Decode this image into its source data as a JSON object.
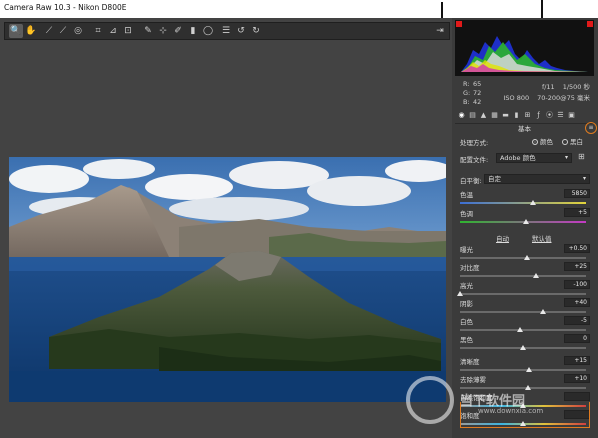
{
  "window": {
    "title": "Camera Raw 10.3 - Nikon D800E"
  },
  "toolbar": {
    "tools": [
      "zoom-icon",
      "hand-icon",
      "white-balance-icon",
      "color-sampler-icon",
      "target-adjust-icon",
      "crop-icon",
      "straighten-icon",
      "transform-icon",
      "spot-removal-icon",
      "red-eye-icon",
      "adjustment-brush-icon",
      "graduated-filter-icon",
      "radial-filter-icon",
      "presets-list-icon",
      "rotate-ccw-icon",
      "rotate-cw-icon"
    ],
    "right_tool": "open-preferences-icon"
  },
  "readout": {
    "r_label": "R:",
    "r": "65",
    "g_label": "G:",
    "g": "72",
    "b_label": "B:",
    "b": "42",
    "aperture": "f/11",
    "shutter": "1/500 秒",
    "iso": "ISO 800",
    "lens": "70-200@75 毫米"
  },
  "panel": {
    "section_title": "基本",
    "treatment_label": "处理方式:",
    "treatment_color": "颜色",
    "treatment_bw": "黑白",
    "profile_label": "配置文件:",
    "profile_value": "Adobe 颜色",
    "wb_label": "白平衡:",
    "wb_value": "自定",
    "auto_label": "自动",
    "default_label": "默认值"
  },
  "sliders": [
    {
      "label": "色温",
      "value": "5850"
    },
    {
      "label": "色调",
      "value": "+5"
    },
    {
      "label": "曝光",
      "value": "+0.50"
    },
    {
      "label": "对比度",
      "value": "+25"
    },
    {
      "label": "高光",
      "value": "-100"
    },
    {
      "label": "阴影",
      "value": "+40"
    },
    {
      "label": "白色",
      "value": "-5"
    },
    {
      "label": "黑色",
      "value": "0"
    },
    {
      "label": "清晰度",
      "value": "+15"
    },
    {
      "label": "去除薄雾",
      "value": "+10"
    },
    {
      "label": "自然饱和度",
      "value": ""
    },
    {
      "label": "饱和度",
      "value": ""
    }
  ],
  "slider_levels": [
    0.58,
    0.52,
    0.53,
    0.6,
    0.0,
    0.66,
    0.48,
    0.5,
    0.55,
    0.54,
    0.5,
    0.5
  ],
  "watermark": {
    "text": "当下软件园",
    "url": "www.downxia.com"
  },
  "colors": {
    "panel_bg": "#3b3b3b",
    "app_bg": "#434343",
    "accent_orange": "#e07b1f",
    "histogram_clip_red": "#e11a1a"
  }
}
